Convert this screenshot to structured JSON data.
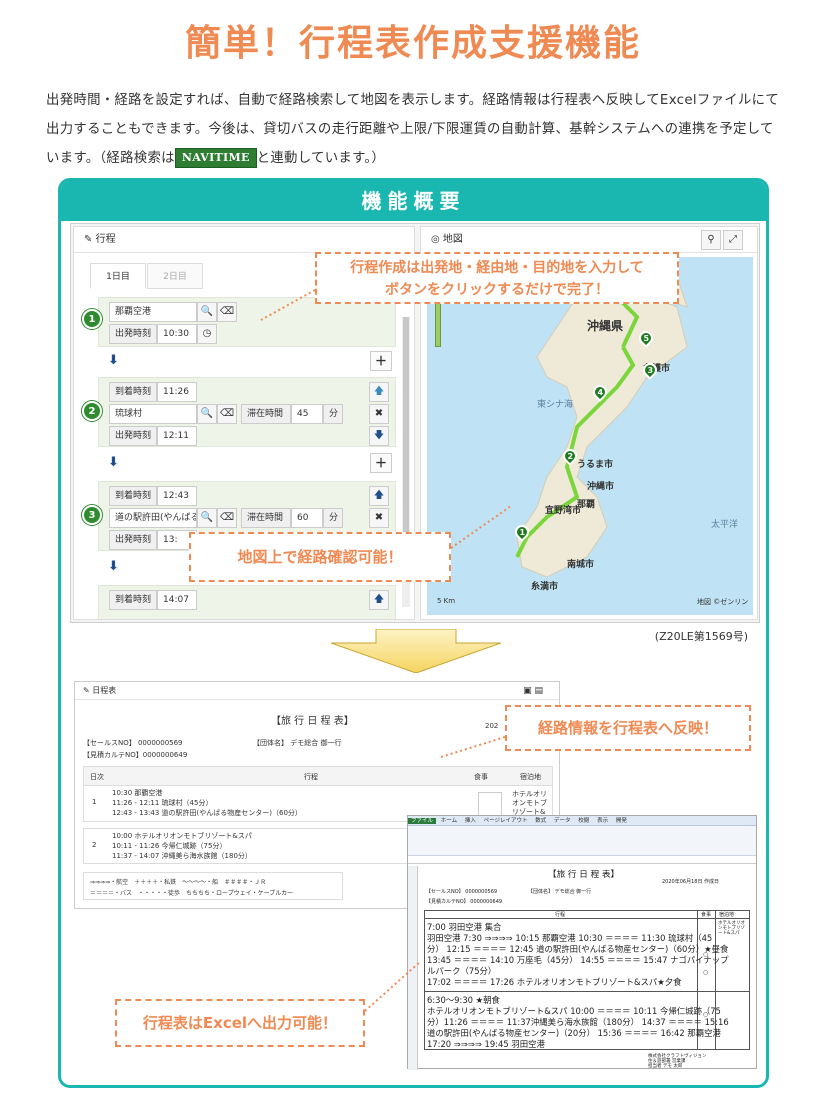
{
  "title": {
    "part1": "簡単！",
    "part2": "行程表作成支援機能"
  },
  "intro": {
    "text_before": "出発時間・経路を設定すれば、自動で経路検索して地図を表示します。経路情報は行程表へ反映してExcelファイルにて出力することもできます。今後は、貸切バスの走行距離や上限/下限運賃の自動計算、基幹システムへの連携を予定しています。（経路検索は",
    "badge": "NAVITIME",
    "text_after": "と連動しています。）"
  },
  "panel": {
    "title": "機能概要"
  },
  "itinerary": {
    "header": "行程",
    "tabs": [
      "1日目",
      "2日目"
    ],
    "stops": [
      {
        "num": "1",
        "place": "那覇空港",
        "depart_label": "出発時刻",
        "depart_time": "10:30"
      },
      {
        "num": "2",
        "arrive_label": "到着時刻",
        "arrive_time": "11:26",
        "place": "琉球村",
        "stay_label": "滞在時間",
        "stay_value": "45",
        "stay_unit": "分",
        "depart_label": "出発時刻",
        "depart_time": "12:11"
      },
      {
        "num": "3",
        "arrive_label": "到着時刻",
        "arrive_time": "12:43",
        "place": "道の駅許田(やんばる",
        "stay_label": "滞在時間",
        "stay_value": "60",
        "stay_unit": "分",
        "depart_label": "出発時刻",
        "depart_time": "13:"
      },
      {
        "arrive_label": "到着時刻",
        "arrive_time": "14:07"
      }
    ]
  },
  "map": {
    "header": "地図",
    "labels": {
      "prefecture": "沖縄県",
      "nago": "名護市",
      "naha": "那覇",
      "uruma": "うるま市",
      "okinawa": "沖縄市",
      "ginowan": "宜野湾市",
      "nanjo": "南城市",
      "itoman": "糸満市",
      "sea_east": "東シナ海",
      "pacific": "太平洋",
      "scale": "5 Km",
      "credit": "地図 ©ゼンリン"
    },
    "pins": [
      "1",
      "2",
      "3",
      "4",
      "5"
    ]
  },
  "callouts": {
    "create": [
      "行程作成は出発地・経由地・目的地を入力して",
      "ボタンをクリックするだけで完了！"
    ],
    "map": "地図上で経路確認可能！",
    "reflect": "経路情報を行程表へ反映！",
    "excel": "行程表はExcelへ出力可能！"
  },
  "code": "(Z20LE第1569号)",
  "schedule": {
    "header": "日程表",
    "title": "【旅 行 日 程 表】",
    "year": "202",
    "sales_no": "【セールスNO】 0000000569",
    "karte_no": "【見積カルテNO】0000000649",
    "group": "【団体名】 デモ総合 御一行",
    "cols": [
      "日次",
      "行程",
      "食事",
      "宿泊地"
    ],
    "day1_num": "1",
    "day1_lines": [
      "10:30 那覇空港",
      "11:26 - 12:11 琉球村（45分）",
      "12:43 - 13:43 道の駅許田(やんばる物産センター)（60分）"
    ],
    "day1_hotel": "ホテルオリオンモトブリゾート&スパ",
    "day2_num": "2",
    "day2_lines": [
      "10:00 ホテルオリオンモトブリゾート&スパ",
      "10:11 - 11:26 今帰仁城跡（75分）",
      "11:37 - 14:07 沖縄美ら海水族館（180分）"
    ],
    "legend1": "⇒⇒⇒⇒・航空　＋＋＋＋・私鉄　〜〜〜〜・船　＃＃＃＃・ＪＲ",
    "legend2": "＝＝＝＝・バス　・・・・・徒歩　ちちちち・ロープウェイ・ケーブルカー"
  },
  "excel": {
    "tabs": [
      "ファイル",
      "ホーム",
      "挿入",
      "ページレイアウト",
      "数式",
      "データ",
      "校閲",
      "表示",
      "開発"
    ],
    "title": "【旅 行 日 程 表】",
    "date": "2020年06月18日 作成日",
    "sales": "【セールスNO】 0000000569",
    "group": "【団体名】 デモ総合 御一行",
    "karte": "【見積カルテNO】 0000000649",
    "col_schedule": "行程",
    "col_meal": "食事",
    "col_hotel": "宿泊地",
    "day1": [
      "7:00 羽田空港 集合",
      "羽田空港 7:30 ⇒⇒⇒⇒ 10:15 那覇空港 10:30 ＝＝＝＝ 11:30 琉球村（45",
      "分） 12:15 ＝＝＝＝ 12:45 道の駅許田(やんばる物産センター)（60分）★昼食",
      "13:45 ＝＝＝＝ 14:10 万座毛（45分） 14:55 ＝＝＝＝ 15:47 ナゴパイナップ",
      "ルパーク（75分）",
      "17:02 ＝＝＝＝ 17:26 ホテルオリオンモトブリゾート&スパ★夕食"
    ],
    "day2": [
      "6:30〜9:30 ★朝食",
      "ホテルオリオンモトブリゾート&スパ 10:00 ＝＝＝＝ 10:11 今帰仁城跡（75",
      "分）11:26 ＝＝＝＝ 11:37沖縄美ら海水族館（180分） 14:37 ＝＝＝＝ 15:16",
      "道の駅許田(やんばる物産センター)（20分） 15:36 ＝＝＝＝ 16:42 那覇空港",
      "17:20 ⇒⇒⇒⇒ 19:45 羽田空港"
    ],
    "hotel1": "ホテルオリオンモトブリゾート&スパ",
    "meal_mark": "○",
    "company": [
      "株式会社クラフトヴィジョン",
      "住＆遊部署 営業課",
      "担当者 デモ 太郎"
    ]
  }
}
